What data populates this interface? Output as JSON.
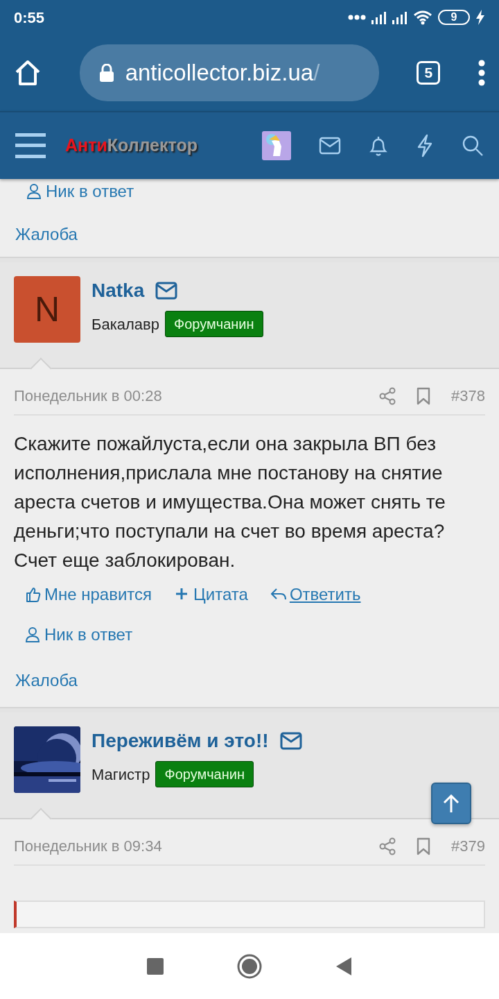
{
  "status_bar": {
    "time": "0:55",
    "battery": "9"
  },
  "browser": {
    "url": "anticollector.biz.ua",
    "url_tail": "/",
    "tab_count": "5"
  },
  "site_nav": {
    "logo_accent": "Анти",
    "logo_rest": "Коллектор"
  },
  "previous_post": {
    "actions": [
      {
        "label": "Ник в ответ",
        "kind": "mention",
        "underlined": false
      }
    ],
    "report": "Жалоба"
  },
  "posts": [
    {
      "author": "Natka",
      "avatar": {
        "kind": "letter",
        "letter": "N",
        "color": "#c9502f"
      },
      "rank": "Бакалавр",
      "badge": "Форумчанин",
      "date": "Понедельник в 00:28",
      "number": "#378",
      "body": "Скажите пожайлуста,если она закрыла ВП без исполнения,прислала мне постанову на снятие ареста счетов и имущества.Она может снять те деньги;что поступали на счет во время ареста? Счет еще заблокирован.",
      "actions": [
        {
          "label": "Мне нравится",
          "kind": "like",
          "underlined": false
        },
        {
          "label": "Цитата",
          "kind": "quote",
          "underlined": false
        },
        {
          "label": "Ответить",
          "kind": "reply",
          "underlined": true
        },
        {
          "label": "Ник в ответ",
          "kind": "mention",
          "underlined": false
        }
      ],
      "report": "Жалоба"
    },
    {
      "author": "Переживём и это!!",
      "rank": "Магистр",
      "badge": "Форумчанин",
      "date": "Понедельник в 09:34",
      "number": "#379"
    }
  ]
}
